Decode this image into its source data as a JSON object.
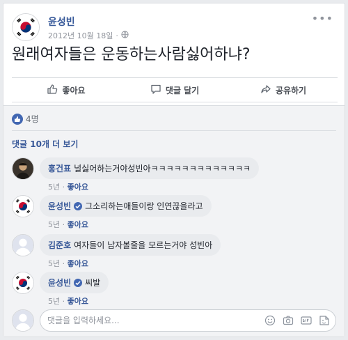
{
  "post": {
    "author": "윤성빈",
    "date": "2012년 10월 18일",
    "meta_separator": "·",
    "text": "원래여자들은 운동하는사람싫어하냐?"
  },
  "actions": {
    "like": "좋아요",
    "comment": "댓글 달기",
    "share": "공유하기"
  },
  "reactions": {
    "count": "4명"
  },
  "more_comments": "댓글 10개 더 보기",
  "comments": [
    {
      "name": "홍건표",
      "text": "널싫어하는거야성빈아ㅋㅋㅋㅋㅋㅋㅋㅋㅋㅋㅋㅋㅋ",
      "time": "5년",
      "like": "좋아요"
    },
    {
      "name": "윤성빈",
      "text": "그소리하는애들이랑 인연끊을라고",
      "time": "5년",
      "like": "좋아요"
    },
    {
      "name": "김준호",
      "text": "여자들이 남자볼줄을 모르는거야 성빈아",
      "time": "5년",
      "like": "좋아요"
    },
    {
      "name": "윤성빈",
      "text": "씨발",
      "time": "5년",
      "like": "좋아요"
    }
  ],
  "footer_separator": "·",
  "reply": {
    "placeholder": "댓글을 입력하세요..."
  },
  "colors": {
    "link": "#385898",
    "accent": "#4267b2",
    "background": "#f2f3f5"
  },
  "icons": [
    "more-options-icon",
    "globe-icon",
    "like-icon",
    "comment-icon",
    "share-icon",
    "like-reaction-icon",
    "verified-icon",
    "emoji-icon",
    "camera-icon",
    "gif-icon",
    "sticker-icon"
  ]
}
